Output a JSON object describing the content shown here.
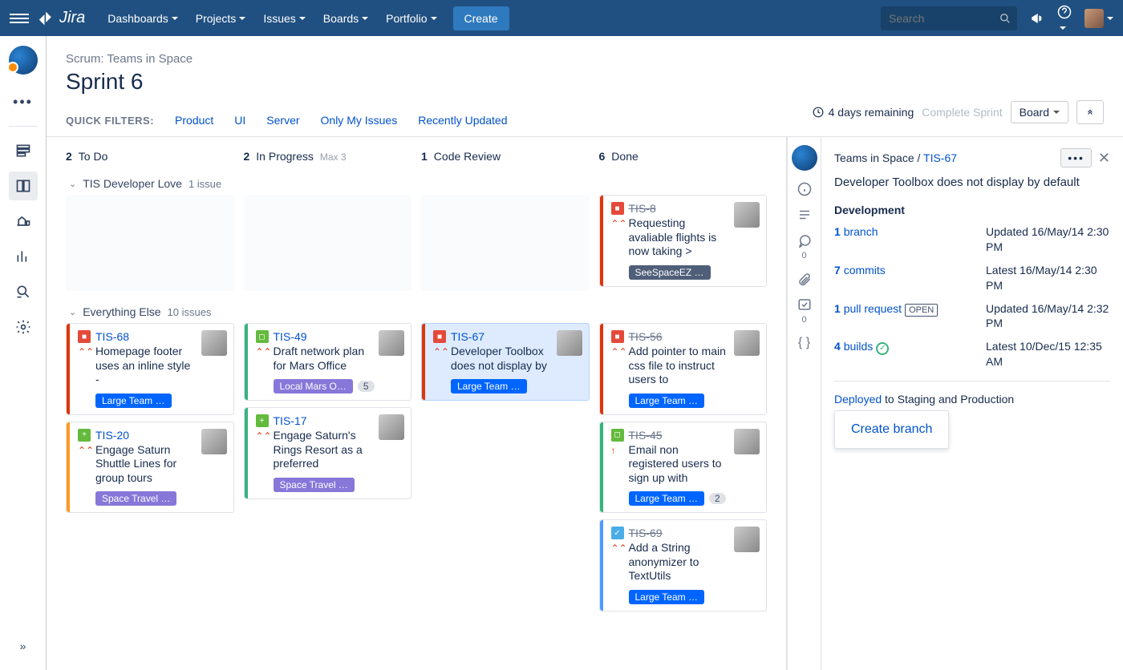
{
  "nav": {
    "logo": "Jira",
    "items": [
      "Dashboards",
      "Projects",
      "Issues",
      "Boards",
      "Portfolio"
    ],
    "create": "Create",
    "search_placeholder": "Search"
  },
  "header": {
    "path": "Scrum: Teams in Space",
    "sprint": "Sprint 6",
    "remaining": "4 days remaining",
    "complete": "Complete Sprint",
    "board_menu": "Board"
  },
  "filters": {
    "label": "QUICK FILTERS:",
    "items": [
      "Product",
      "UI",
      "Server",
      "Only My Issues",
      "Recently Updated"
    ]
  },
  "columns": [
    {
      "count": "2",
      "name": "To Do",
      "max": ""
    },
    {
      "count": "2",
      "name": "In Progress",
      "max": "Max 3"
    },
    {
      "count": "1",
      "name": "Code Review",
      "max": ""
    },
    {
      "count": "6",
      "name": "Done",
      "max": ""
    }
  ],
  "swimlanes": {
    "s1": {
      "name": "TIS Developer Love",
      "meta": "1 issue"
    },
    "s2": {
      "name": "Everything Else",
      "meta": "10 issues"
    }
  },
  "cards": {
    "tis8": {
      "key": "TIS-8",
      "summary": "Requesting avaliable flights is now taking >",
      "epic": "SeeSpaceEZ …"
    },
    "tis68": {
      "key": "TIS-68",
      "summary": "Homepage footer uses an inline style -",
      "epic": "Large Team …"
    },
    "tis49": {
      "key": "TIS-49",
      "summary": "Draft network plan for Mars Office",
      "epic": "Local Mars O…",
      "badge": "5"
    },
    "tis67": {
      "key": "TIS-67",
      "summary": "Developer Toolbox does not display by",
      "epic": "Large Team …"
    },
    "tis56": {
      "key": "TIS-56",
      "summary": "Add pointer to main css file to instruct users to",
      "epic": "Large Team …"
    },
    "tis20": {
      "key": "TIS-20",
      "summary": "Engage Saturn Shuttle Lines for group tours",
      "epic": "Space Travel …"
    },
    "tis17": {
      "key": "TIS-17",
      "summary": "Engage Saturn's Rings Resort as a preferred",
      "epic": "Space Travel …"
    },
    "tis45": {
      "key": "TIS-45",
      "summary": "Email non registered users to sign up with",
      "epic": "Large Team …",
      "badge": "2"
    },
    "tis69": {
      "key": "TIS-69",
      "summary": "Add a String anonymizer to TextUtils",
      "epic": "Large Team …"
    }
  },
  "detail": {
    "project": "Teams in Space",
    "sep": "/",
    "key": "TIS-67",
    "title": "Developer Toolbox does not display by default",
    "dev_heading": "Development",
    "rows": {
      "branch": {
        "n": "1",
        "label": "branch",
        "r": "Updated 16/May/14 2:30 PM"
      },
      "commits": {
        "n": "7",
        "label": "commits",
        "r": "Latest 16/May/14 2:30 PM"
      },
      "pr": {
        "n": "1",
        "label": "pull request",
        "status": "OPEN",
        "r": "Updated 16/May/14 2:32 PM"
      },
      "builds": {
        "n": "4",
        "label": "builds",
        "r": "Latest 10/Dec/15 12:35 AM"
      }
    },
    "deployed_label": "Deployed",
    "deployed_text": " to Staging and Production",
    "create_branch": "Create branch",
    "comment_count": "0",
    "sub_count": "0"
  }
}
